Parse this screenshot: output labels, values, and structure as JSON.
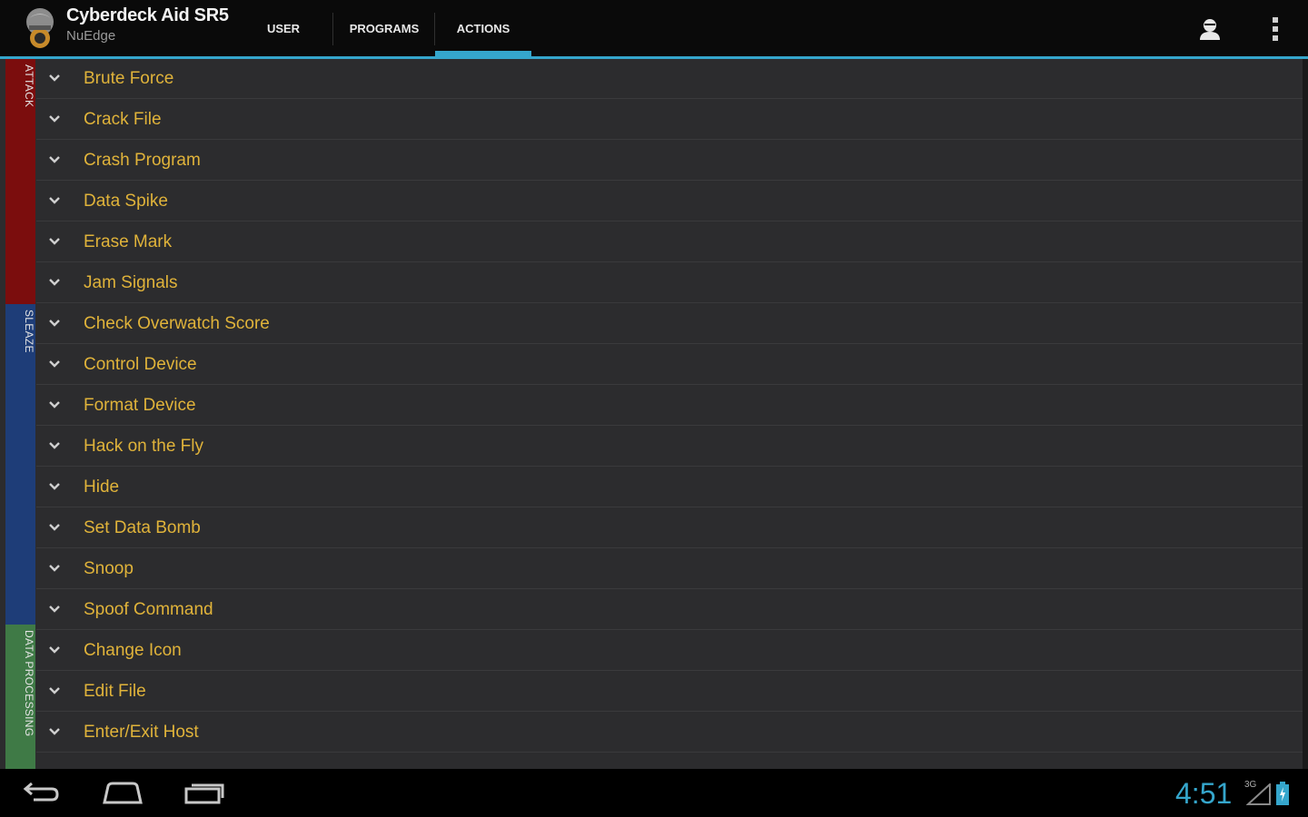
{
  "app": {
    "title": "Cyberdeck Aid SR5",
    "subtitle": "NuEdge"
  },
  "tabs": [
    {
      "label": "USER",
      "selected": false
    },
    {
      "label": "PROGRAMS",
      "selected": false
    },
    {
      "label": "ACTIONS",
      "selected": true
    }
  ],
  "actionbar_icons": [
    "person-icon",
    "overflow-menu-icon"
  ],
  "categories": [
    {
      "label": "ATTACK",
      "color": "#7b0d0d"
    },
    {
      "label": "SLEAZE",
      "color": "#1e3d78"
    },
    {
      "label": "DATA PROCESSING",
      "color": "#3f7a46"
    }
  ],
  "actions": [
    "Brute Force",
    "Crack File",
    "Crash Program",
    "Data Spike",
    "Erase Mark",
    "Jam Signals",
    "Check Overwatch Score",
    "Control Device",
    "Format Device",
    "Hack on the Fly",
    "Hide",
    "Set Data Bomb",
    "Snoop",
    "Spoof Command",
    "Change Icon",
    "Edit File",
    "Enter/Exit Host"
  ],
  "colors": {
    "accent": "#35a6cc",
    "action_text": "#e0b33a",
    "background": "#2c2c2e"
  },
  "navbar": {
    "icons": [
      "back-icon",
      "home-icon",
      "recent-apps-icon"
    ]
  },
  "status": {
    "time": "4:51",
    "signal": "3G",
    "icons": [
      "signal-icon",
      "battery-icon"
    ]
  }
}
